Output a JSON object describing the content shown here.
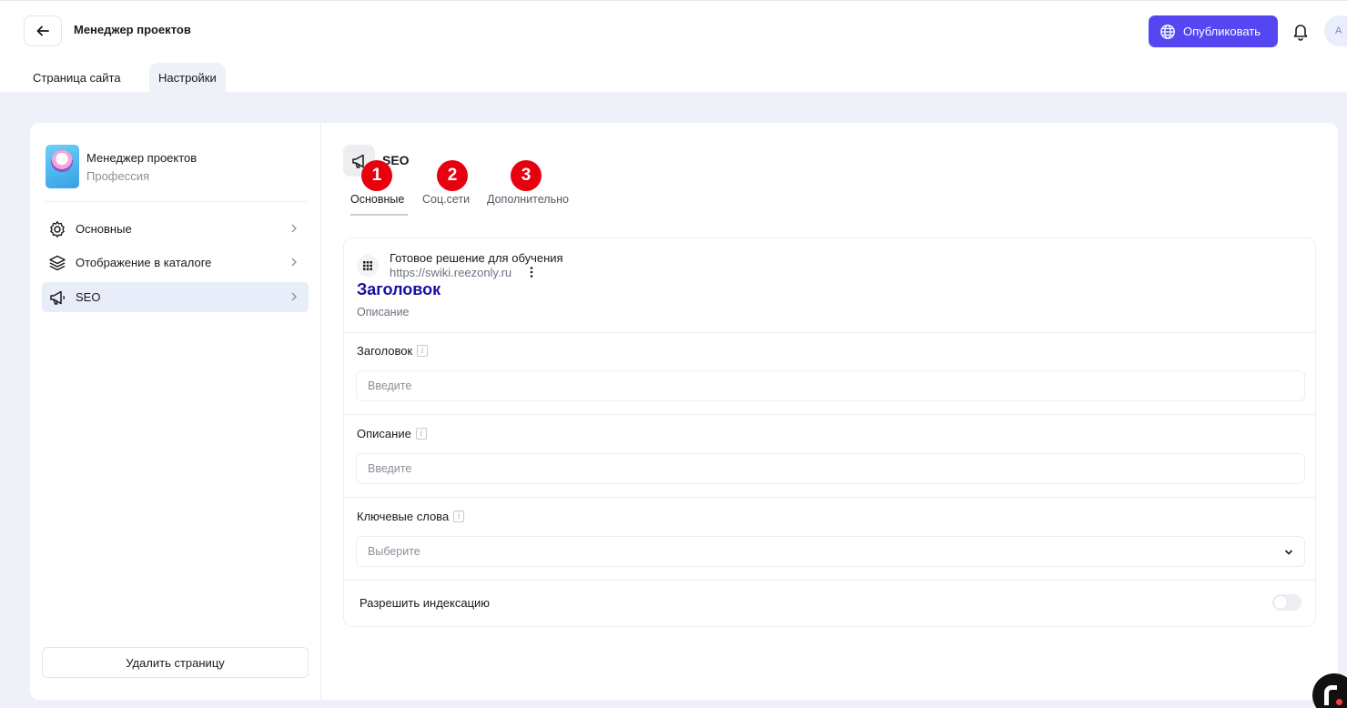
{
  "header": {
    "title": "Менеджер проектов",
    "publish_label": "Опубликовать",
    "avatar_letter": "А"
  },
  "page_tabs": [
    {
      "label": "Страница сайта"
    },
    {
      "label": "Настройки"
    }
  ],
  "sidebar": {
    "project_name": "Менеджер проектов",
    "project_subtitle": "Профессия",
    "items": [
      {
        "label": "Основные",
        "icon": "gear-icon"
      },
      {
        "label": "Отображение в каталоге",
        "icon": "layers-icon"
      },
      {
        "label": "SEO",
        "icon": "megaphone-icon"
      }
    ],
    "delete_label": "Удалить страницу"
  },
  "main": {
    "section_title": "SEO",
    "badges": [
      "1",
      "2",
      "3"
    ],
    "subtabs": [
      {
        "label": "Основные"
      },
      {
        "label": "Соц.сети"
      },
      {
        "label": "Дополнительно"
      }
    ],
    "preview": {
      "site_name": "Готовое решение для обучения",
      "url": "https://swiki.reezonly.ru",
      "title": "Заголовок",
      "description": "Описание"
    },
    "fields": {
      "title_label": "Заголовок",
      "title_placeholder": "Введите",
      "description_label": "Описание",
      "description_placeholder": "Введите",
      "keywords_label": "Ключевые слова",
      "keywords_placeholder": "Выберите",
      "indexing_label": "Разрешить индексацию"
    }
  },
  "colors": {
    "accent": "#5446f0",
    "badge": "#e8000e",
    "preview_title": "#1a0fa0",
    "page_bg": "#eef1f8"
  }
}
